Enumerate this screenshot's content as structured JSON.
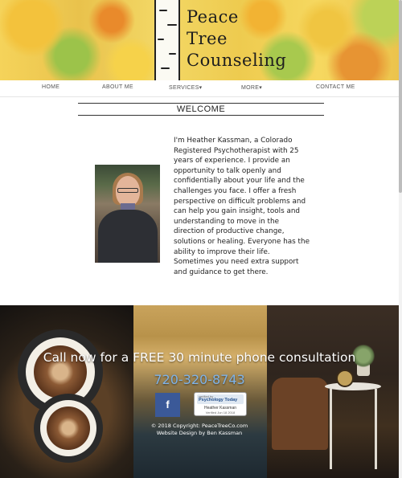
{
  "header": {
    "logo_line1": "Peace",
    "logo_line2": "Tree",
    "logo_line3": "Counseling"
  },
  "nav": {
    "items": [
      {
        "label": "HOME"
      },
      {
        "label": "ABOUT ME"
      },
      {
        "label": "SERVICES▾"
      },
      {
        "label": "MORE▾"
      },
      {
        "label": "CONTACT ME"
      }
    ]
  },
  "main": {
    "heading": "WELCOME",
    "bio": "I'm Heather Kassman, a Colorado Registered Psychotherapist with 25 years of experience. I provide an opportunity to talk openly and confidentially about your life and the challenges you face. I offer a fresh perspective on difficult problems and can help you gain insight, tools and understanding to move in the direction of productive change, solutions or healing. Everyone has the ability to improve their life. Sometimes you need extra support and guidance to get there."
  },
  "footer": {
    "cta": "Call now for a FREE 30 minute phone consultation",
    "phone": "720-320-8743",
    "facebook_glyph": "f",
    "badge": {
      "verified_by": "verified by",
      "brand": "Psychology Today",
      "name": "Heather Kassman",
      "date": "Verified Jun 18 2018"
    },
    "copyright": "© 2018 Copyright: PeaceTreeCo.com",
    "credit": "Website Design by Ben Kassman"
  },
  "colors": {
    "phone_link": "#7fb3e8",
    "facebook": "#3b5998"
  }
}
